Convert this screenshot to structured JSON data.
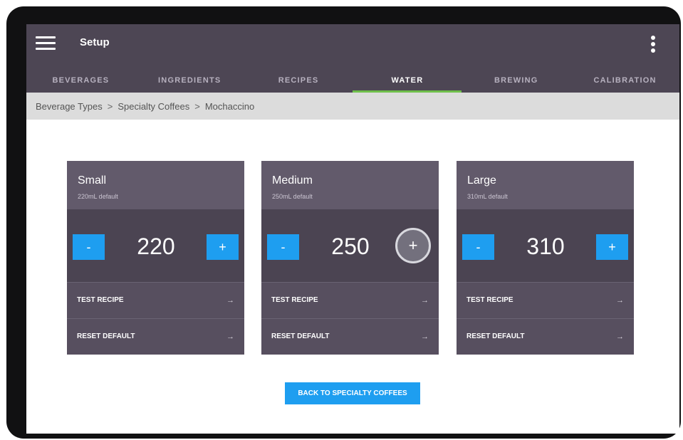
{
  "app": {
    "title": "Setup"
  },
  "tabs": [
    {
      "label": "BEVERAGES"
    },
    {
      "label": "INGREDIENTS"
    },
    {
      "label": "RECIPES"
    },
    {
      "label": "WATER",
      "active": true
    },
    {
      "label": "BREWING"
    },
    {
      "label": "CALIBRATION"
    }
  ],
  "breadcrumb": {
    "items": [
      "Beverage Types",
      "Specialty Coffees",
      "Mochaccino"
    ],
    "separator": ">"
  },
  "cards": [
    {
      "title": "Small",
      "subtitle": "220mL default",
      "value": "220",
      "minus": "-",
      "plus": "+",
      "test": "TEST RECIPE",
      "reset": "RESET DEFAULT",
      "arrow": "→"
    },
    {
      "title": "Medium",
      "subtitle": "250mL default",
      "value": "250",
      "minus": "-",
      "plus": "+",
      "test": "TEST RECIPE",
      "reset": "RESET DEFAULT",
      "arrow": "→"
    },
    {
      "title": "Large",
      "subtitle": "310mL default",
      "value": "310",
      "minus": "-",
      "plus": "+",
      "test": "TEST RECIPE",
      "reset": "RESET DEFAULT",
      "arrow": "→"
    }
  ],
  "back_button": {
    "label": "BACK TO SPECIALTY COFFEES"
  },
  "icons": {
    "menu": "hamburger-menu-icon",
    "overflow": "more-vertical-icon",
    "arrow": "arrow-right-icon"
  },
  "colors": {
    "appbar": "#4d4654",
    "accent_blue": "#1e9ef0",
    "active_tab_indicator": "#6fbf4b",
    "card_body": "#574f5f",
    "breadcrumb_bg": "#dcdcdc"
  }
}
